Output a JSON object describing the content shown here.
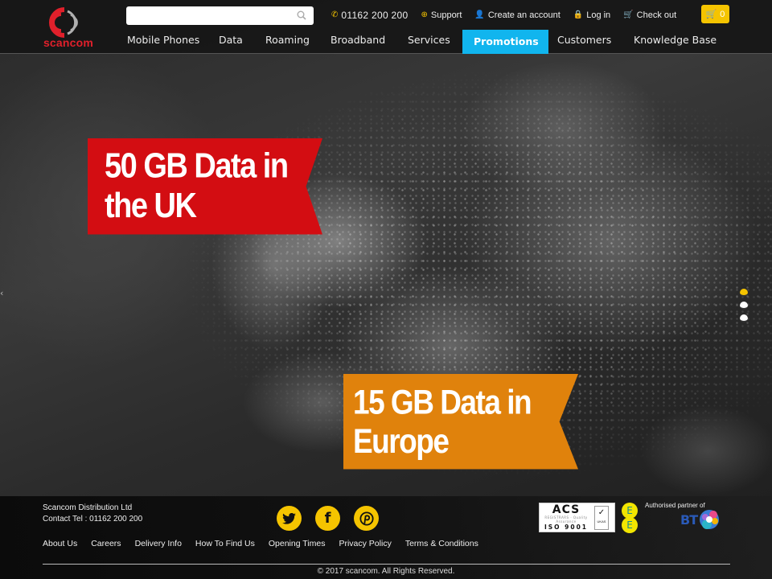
{
  "brand": {
    "name": "scancom",
    "logo_color": "#e0202b"
  },
  "header": {
    "search": {
      "value": "",
      "placeholder": ""
    },
    "top_links": [
      {
        "icon": "phone-icon",
        "label": "01162 200 200"
      },
      {
        "icon": "lifebuoy-icon",
        "label": "Support"
      },
      {
        "icon": "user-icon",
        "label": "Create an account"
      },
      {
        "icon": "lock-icon",
        "label": "Log in"
      },
      {
        "icon": "cart-icon",
        "label": "Check out"
      }
    ],
    "cart": {
      "icon": "cart-icon",
      "count": "0"
    },
    "nav": [
      {
        "label": "Mobile Phones",
        "active": false
      },
      {
        "label": "Data",
        "active": false
      },
      {
        "label": "Roaming",
        "active": false
      },
      {
        "label": "Broadband",
        "active": false
      },
      {
        "label": "Services",
        "active": false
      },
      {
        "label": "Promotions",
        "active": true
      },
      {
        "label": "Customers",
        "active": false
      },
      {
        "label": "Knowledge Base",
        "active": false
      }
    ]
  },
  "hero": {
    "banners": [
      {
        "text": "50 GB Data in the UK",
        "color": "#d30d12"
      },
      {
        "text": "15 GB Data in Europe",
        "color": "#e0820c"
      }
    ],
    "slider": {
      "total": 3,
      "active_index": 0
    },
    "prev_arrow": "‹"
  },
  "footer": {
    "company": "Scancom Distribution Ltd",
    "contact": "Contact Tel : 01162 200 200",
    "social": [
      {
        "name": "twitter",
        "glyph": "🐦"
      },
      {
        "name": "facebook",
        "glyph": "f"
      },
      {
        "name": "pinterest",
        "glyph": "P"
      }
    ],
    "links": [
      "About Us",
      "Careers",
      "Delivery Info",
      "How To Find Us",
      "Opening Times",
      "Privacy Policy",
      "Terms & Conditions"
    ],
    "badges": {
      "acs_title": "ACS",
      "acs_sub": "REGISTRARS · Quality Assurance",
      "acs_iso": "ISO 9001",
      "ukas": "UKAS",
      "ee": "EE",
      "partner_label": "Authorised partner of",
      "partner_name": "BT"
    },
    "copyright": "© 2017 scancom. All Rights Reserved."
  },
  "colors": {
    "accent_yellow": "#f5c400",
    "nav_active": "#11b5ee"
  }
}
